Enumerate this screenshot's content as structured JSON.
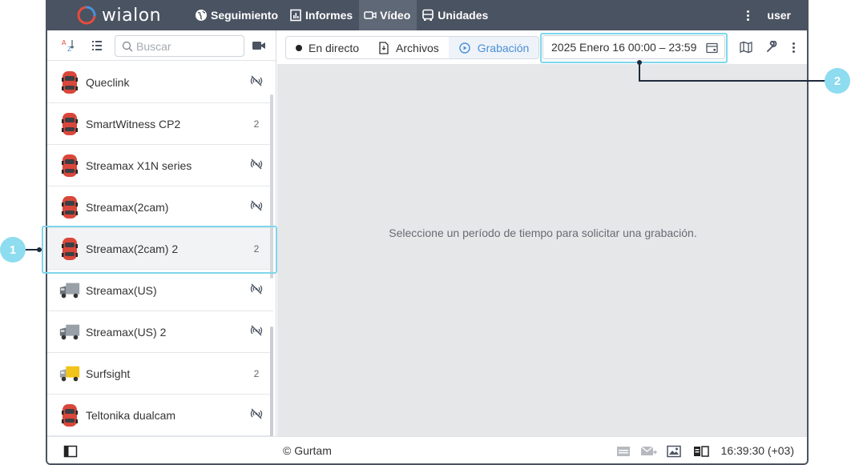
{
  "app": {
    "brand": "wialon",
    "brand_color": "#e74c3c",
    "topbar_color": "#4a5361",
    "accent": "#4a8fd6"
  },
  "nav": [
    {
      "label": "Seguimiento",
      "icon": "globe-icon"
    },
    {
      "label": "Informes",
      "icon": "report-icon"
    },
    {
      "label": "Vídeo",
      "icon": "video-camera-icon",
      "active": true
    },
    {
      "label": "Unidades",
      "icon": "bus-icon"
    }
  ],
  "user": {
    "label": "user"
  },
  "sidebar": {
    "search_placeholder": "Buscar",
    "units": [
      {
        "name": "Queclink",
        "icon": "car-icon",
        "status": "offline-icon",
        "count": ""
      },
      {
        "name": "SmartWitness CP2",
        "icon": "car-icon",
        "status": "count",
        "count": "2"
      },
      {
        "name": "Streamax X1N series",
        "icon": "car-icon",
        "status": "offline-icon",
        "count": ""
      },
      {
        "name": "Streamax(2cam)",
        "icon": "car-icon",
        "status": "offline-icon",
        "count": ""
      },
      {
        "name": "Streamax(2cam) 2",
        "icon": "car-icon",
        "status": "count",
        "count": "2",
        "selected": true
      },
      {
        "name": "Streamax(US)",
        "icon": "truck-icon",
        "status": "offline-icon",
        "count": ""
      },
      {
        "name": "Streamax(US) 2",
        "icon": "truck-icon",
        "status": "offline-icon",
        "count": ""
      },
      {
        "name": "Surfsight",
        "icon": "yellow-truck-icon",
        "status": "count",
        "count": "2"
      },
      {
        "name": "Teltonika dualcam",
        "icon": "car-icon",
        "status": "offline-icon",
        "count": ""
      }
    ]
  },
  "main": {
    "modes": {
      "live": "En directo",
      "files": "Archivos",
      "recording": "Grabación"
    },
    "date_range": "2025 Enero 16 00:00 – 23:59",
    "empty_message": "Seleccione un período de tiempo para solicitar una grabación."
  },
  "footer": {
    "copyright": "© Gurtam",
    "clock": "16:39:30 (+03)"
  },
  "callouts": {
    "one": "1",
    "two": "2",
    "color": "#8ddcf0"
  }
}
